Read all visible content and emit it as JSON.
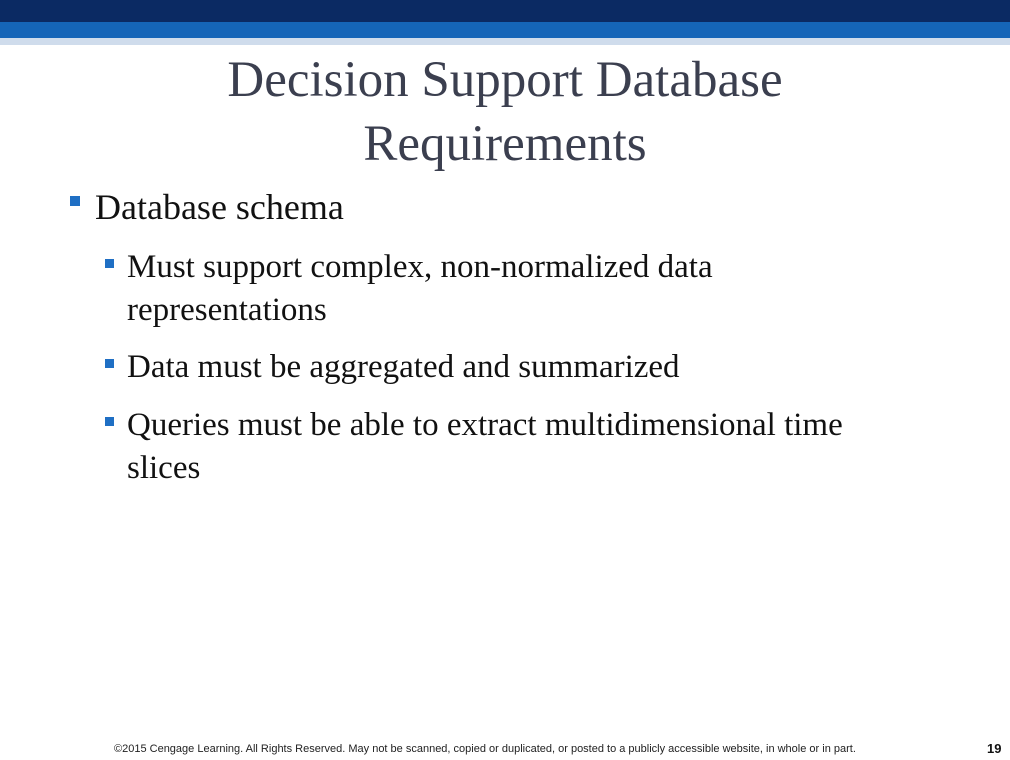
{
  "slide": {
    "title_lines": [
      "Decision Support Database",
      "Requirements"
    ],
    "bullets": [
      {
        "text": "Database schema",
        "children": [
          {
            "line1": "Must support complex, non-normalized data",
            "line2": "representations"
          },
          {
            "line1": "Data must be aggregated and summarized",
            "line2": ""
          },
          {
            "line1": "Queries must be able to extract multidimensional time",
            "line2": "slices"
          }
        ]
      }
    ],
    "footer": "©2015 Cengage Learning. All Rights Reserved. May not be scanned, copied or duplicated, or posted to a publicly accessible website, in whole or in part.",
    "page_number": "19"
  },
  "colors": {
    "top_band_dark": "#0b2a63",
    "top_band_blue": "#1565b8",
    "top_band_light": "#cfdcec",
    "bullet_marker": "#1f6fc4",
    "title_text": "#3b3f4f"
  }
}
